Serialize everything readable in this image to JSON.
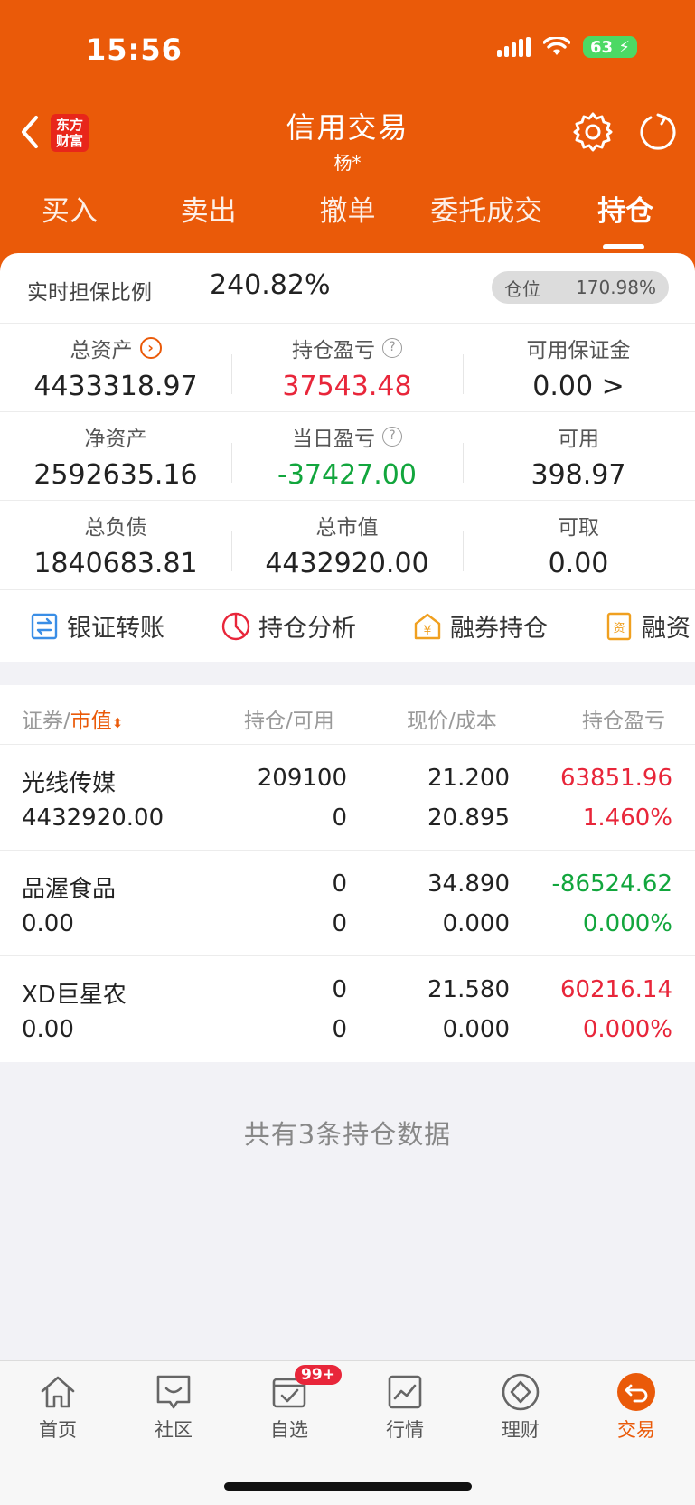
{
  "status_bar": {
    "time": "15:56",
    "battery": "63"
  },
  "header": {
    "logo_line1": "东方",
    "logo_line2": "财富",
    "title": "信用交易",
    "subtitle": "杨*"
  },
  "tabs": [
    {
      "label": "买入"
    },
    {
      "label": "卖出"
    },
    {
      "label": "撤单"
    },
    {
      "label": "委托成交"
    },
    {
      "label": "持仓"
    }
  ],
  "ratio": {
    "label": "实时担保比例",
    "value": "240.82%",
    "position_label": "仓位",
    "position_value": "170.98%"
  },
  "stats": [
    [
      {
        "label": "总资产",
        "value": "4433318.97"
      },
      {
        "label": "持仓盈亏",
        "value": "37543.48"
      },
      {
        "label": "可用保证金",
        "value": "0.00 >"
      }
    ],
    [
      {
        "label": "净资产",
        "value": "2592635.16"
      },
      {
        "label": "当日盈亏",
        "value": "-37427.00"
      },
      {
        "label": "可用",
        "value": "398.97"
      }
    ],
    [
      {
        "label": "总负债",
        "value": "1840683.81"
      },
      {
        "label": "总市值",
        "value": "4432920.00"
      },
      {
        "label": "可取",
        "value": "0.00"
      }
    ]
  ],
  "shortcuts": [
    {
      "label": "银证转账",
      "icon": "transfer-icon"
    },
    {
      "label": "持仓分析",
      "icon": "pie-chart-icon"
    },
    {
      "label": "融券持仓",
      "icon": "yen-house-icon"
    },
    {
      "label": "融资",
      "icon": "document-icon"
    }
  ],
  "colors": {
    "brand": "#ea5a09",
    "up": "#e8263a",
    "down": "#12a63d"
  },
  "list_header": {
    "col1_a": "证券/",
    "col1_b": "市值",
    "col2": "持仓/可用",
    "col3": "现价/成本",
    "col4": "持仓盈亏"
  },
  "holdings": [
    {
      "name": "光线传媒",
      "market_value": "4432920.00",
      "position": "209100",
      "available": "0",
      "price": "21.200",
      "cost": "20.895",
      "pnl": "63851.96",
      "pnl_pct": "1.460%",
      "trend": "up"
    },
    {
      "name": "品渥食品",
      "market_value": "0.00",
      "position": "0",
      "available": "0",
      "price": "34.890",
      "cost": "0.000",
      "pnl": "-86524.62",
      "pnl_pct": "0.000%",
      "trend": "down"
    },
    {
      "name": "XD巨星农",
      "market_value": "0.00",
      "position": "0",
      "available": "0",
      "price": "21.580",
      "cost": "0.000",
      "pnl": "60216.14",
      "pnl_pct": "0.000%",
      "trend": "up"
    }
  ],
  "footer_note": "共有3条持仓数据",
  "bottom_nav": [
    {
      "label": "首页",
      "icon": "home-icon"
    },
    {
      "label": "社区",
      "icon": "chat-icon"
    },
    {
      "label": "自选",
      "icon": "watchlist-icon",
      "badge": "99+"
    },
    {
      "label": "行情",
      "icon": "chart-icon"
    },
    {
      "label": "理财",
      "icon": "diamond-icon"
    },
    {
      "label": "交易",
      "icon": "trade-icon"
    }
  ]
}
